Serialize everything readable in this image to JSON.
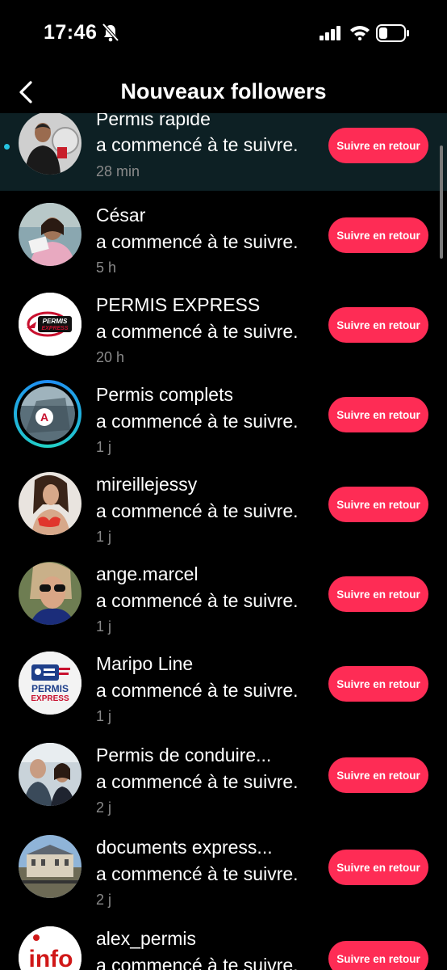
{
  "status_bar": {
    "time": "17:46"
  },
  "header": {
    "title": "Nouveaux followers"
  },
  "colors": {
    "accent": "#fe2c55",
    "unread_dot": "#25c3e0",
    "unread_bg": "#0d2024"
  },
  "followers": [
    {
      "name": "Permis rapide",
      "message": "a commencé à te suivre.",
      "time": "28 min",
      "button": "Suivre en retour",
      "unread": true
    },
    {
      "name": "César",
      "message": "a commencé à te suivre.",
      "time": "5 h",
      "button": "Suivre en retour",
      "unread": false
    },
    {
      "name": "PERMIS EXPRESS",
      "message": "a commencé à te suivre.",
      "time": "20 h",
      "button": "Suivre en retour",
      "unread": false
    },
    {
      "name": "Permis complets",
      "message": "a commencé à te suivre.",
      "time": "1 j",
      "button": "Suivre en retour",
      "unread": false
    },
    {
      "name": "mireillejessy",
      "message": "a commencé à te suivre.",
      "time": "1 j",
      "button": "Suivre en retour",
      "unread": false
    },
    {
      "name": "ange.marcel",
      "message": "a commencé à te suivre.",
      "time": "1 j",
      "button": "Suivre en retour",
      "unread": false
    },
    {
      "name": "Maripo Line",
      "message": "a commencé à te suivre.",
      "time": "1 j",
      "button": "Suivre en retour",
      "unread": false
    },
    {
      "name": "Permis de conduire...",
      "message": "a commencé à te suivre.",
      "time": "2 j",
      "button": "Suivre en retour",
      "unread": false
    },
    {
      "name": "documents express...",
      "message": "a commencé à te suivre.",
      "time": "2 j",
      "button": "Suivre en retour",
      "unread": false
    },
    {
      "name": "alex_permis",
      "message": "a commencé à te suivre.",
      "time": "",
      "button": "Suivre en retour",
      "unread": false
    }
  ],
  "avatar_text": {
    "permis_express_logo_line1": "PERMIS",
    "permis_express_logo_line2": "EXPRESS",
    "permis_complets_letter": "A",
    "maripo_logo_line1": "PERMIS",
    "maripo_logo_line2": "EXPRESS",
    "alex_permis_logo": "info"
  }
}
